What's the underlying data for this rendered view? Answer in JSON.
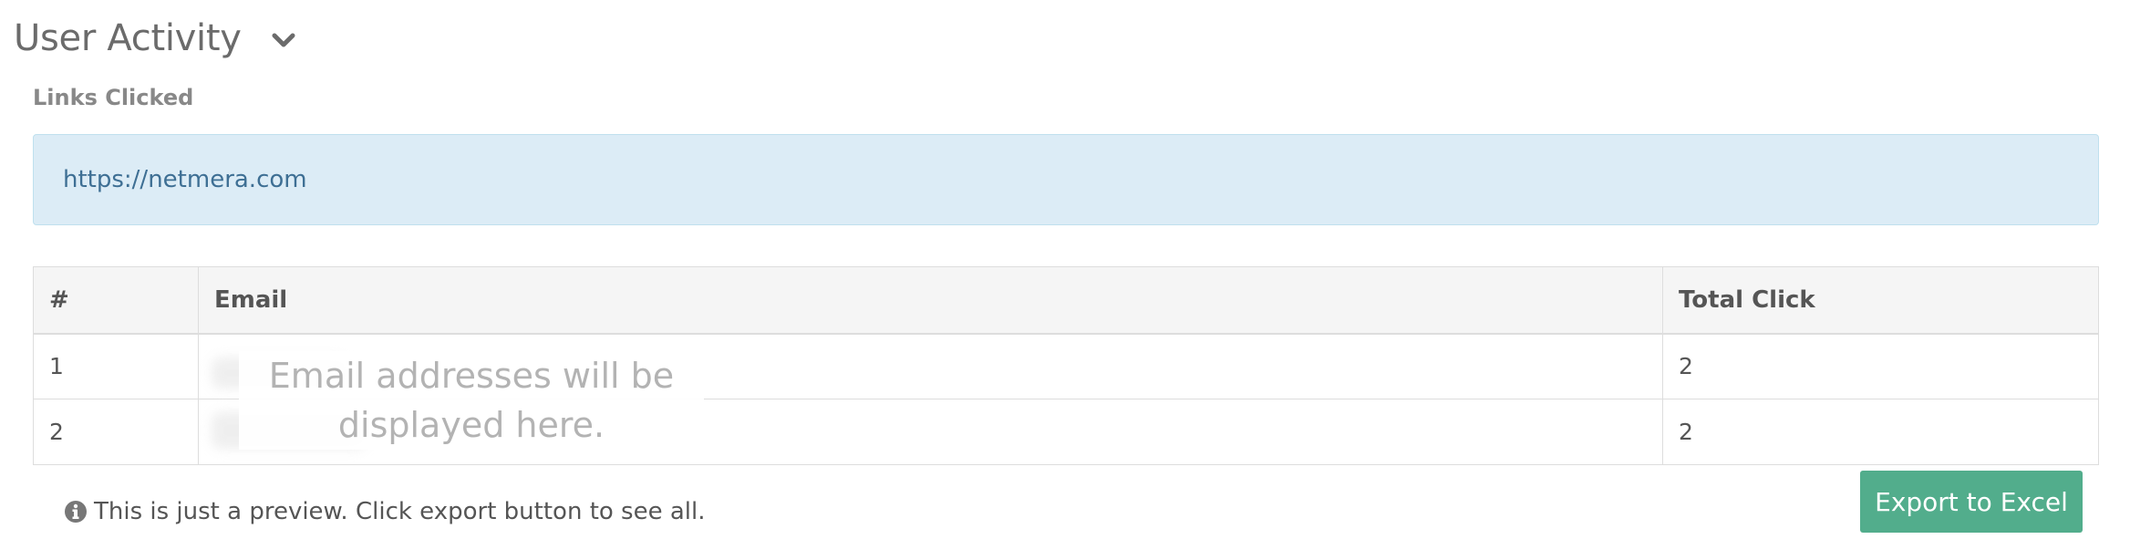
{
  "section": {
    "title": "User Activity",
    "toggle_icon": "chevron-down-icon"
  },
  "links_clicked": {
    "label": "Links Clicked",
    "url": "https://netmera.com"
  },
  "table": {
    "headers": [
      "#",
      "Email",
      "Total Click"
    ],
    "rows": [
      {
        "num": "1",
        "email": "",
        "total": "2"
      },
      {
        "num": "2",
        "email": "",
        "total": "2"
      }
    ],
    "email_placeholder_line1": "Email addresses will be",
    "email_placeholder_line2": "displayed here."
  },
  "footer": {
    "info_icon": "info-circle-icon",
    "preview_note": "This is just a preview. Click export button to see all.",
    "export_label": "Export to Excel"
  },
  "colors": {
    "link_box_bg": "#dcecf6",
    "link_text": "#3e6f94",
    "export_button": "#52ad8c"
  }
}
